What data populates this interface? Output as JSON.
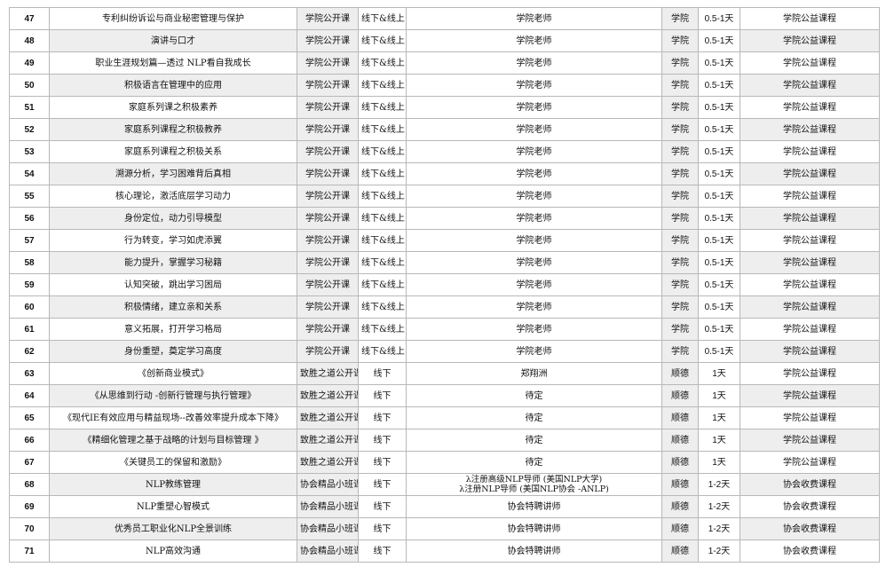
{
  "rows": [
    {
      "no": "47",
      "name": "专利纠纷诉讼与商业秘密管理与保护",
      "type": "学院公开课",
      "mode": "线下&线上",
      "teacher": [
        "学院老师"
      ],
      "place": "学院",
      "duration": "0.5-1天",
      "category": "学院公益课程"
    },
    {
      "no": "48",
      "name": "演讲与口才",
      "type": "学院公开课",
      "mode": "线下&线上",
      "teacher": [
        "学院老师"
      ],
      "place": "学院",
      "duration": "0.5-1天",
      "category": "学院公益课程"
    },
    {
      "no": "49",
      "name": "职业生涯规划篇—透过 NLP看自我成长",
      "type": "学院公开课",
      "mode": "线下&线上",
      "teacher": [
        "学院老师"
      ],
      "place": "学院",
      "duration": "0.5-1天",
      "category": "学院公益课程"
    },
    {
      "no": "50",
      "name": "积极语言在管理中的应用",
      "type": "学院公开课",
      "mode": "线下&线上",
      "teacher": [
        "学院老师"
      ],
      "place": "学院",
      "duration": "0.5-1天",
      "category": "学院公益课程"
    },
    {
      "no": "51",
      "name": "家庭系列课之积极素养",
      "type": "学院公开课",
      "mode": "线下&线上",
      "teacher": [
        "学院老师"
      ],
      "place": "学院",
      "duration": "0.5-1天",
      "category": "学院公益课程"
    },
    {
      "no": "52",
      "name": "家庭系列课程之积极教养",
      "type": "学院公开课",
      "mode": "线下&线上",
      "teacher": [
        "学院老师"
      ],
      "place": "学院",
      "duration": "0.5-1天",
      "category": "学院公益课程"
    },
    {
      "no": "53",
      "name": "家庭系列课程之积极关系",
      "type": "学院公开课",
      "mode": "线下&线上",
      "teacher": [
        "学院老师"
      ],
      "place": "学院",
      "duration": "0.5-1天",
      "category": "学院公益课程"
    },
    {
      "no": "54",
      "name": "溯源分析，学习困难背后真相",
      "type": "学院公开课",
      "mode": "线下&线上",
      "teacher": [
        "学院老师"
      ],
      "place": "学院",
      "duration": "0.5-1天",
      "category": "学院公益课程"
    },
    {
      "no": "55",
      "name": "核心理论，激活底层学习动力",
      "type": "学院公开课",
      "mode": "线下&线上",
      "teacher": [
        "学院老师"
      ],
      "place": "学院",
      "duration": "0.5-1天",
      "category": "学院公益课程"
    },
    {
      "no": "56",
      "name": "身份定位，动力引导模型",
      "type": "学院公开课",
      "mode": "线下&线上",
      "teacher": [
        "学院老师"
      ],
      "place": "学院",
      "duration": "0.5-1天",
      "category": "学院公益课程"
    },
    {
      "no": "57",
      "name": "行为转变，学习如虎添翼",
      "type": "学院公开课",
      "mode": "线下&线上",
      "teacher": [
        "学院老师"
      ],
      "place": "学院",
      "duration": "0.5-1天",
      "category": "学院公益课程"
    },
    {
      "no": "58",
      "name": "能力提升，掌握学习秘籍",
      "type": "学院公开课",
      "mode": "线下&线上",
      "teacher": [
        "学院老师"
      ],
      "place": "学院",
      "duration": "0.5-1天",
      "category": "学院公益课程"
    },
    {
      "no": "59",
      "name": "认知突破，跳出学习困局",
      "type": "学院公开课",
      "mode": "线下&线上",
      "teacher": [
        "学院老师"
      ],
      "place": "学院",
      "duration": "0.5-1天",
      "category": "学院公益课程"
    },
    {
      "no": "60",
      "name": "积极情绪，建立亲和关系",
      "type": "学院公开课",
      "mode": "线下&线上",
      "teacher": [
        "学院老师"
      ],
      "place": "学院",
      "duration": "0.5-1天",
      "category": "学院公益课程"
    },
    {
      "no": "61",
      "name": "意义拓展，打开学习格局",
      "type": "学院公开课",
      "mode": "线下&线上",
      "teacher": [
        "学院老师"
      ],
      "place": "学院",
      "duration": "0.5-1天",
      "category": "学院公益课程"
    },
    {
      "no": "62",
      "name": "身份重塑，奠定学习高度",
      "type": "学院公开课",
      "mode": "线下&线上",
      "teacher": [
        "学院老师"
      ],
      "place": "学院",
      "duration": "0.5-1天",
      "category": "学院公益课程"
    },
    {
      "no": "63",
      "name": "《创新商业模式》",
      "type": "致胜之道公开课",
      "mode": "线下",
      "teacher": [
        "郑翔洲"
      ],
      "place": "顺德",
      "duration": "1天",
      "category": "学院公益课程"
    },
    {
      "no": "64",
      "name": "《从思维到行动 -创新行管理与执行管理》",
      "type": "致胜之道公开课",
      "mode": "线下",
      "teacher": [
        "待定"
      ],
      "place": "顺德",
      "duration": "1天",
      "category": "学院公益课程"
    },
    {
      "no": "65",
      "name": "《现代IE有效应用与精益现场--改善效率提升成本下降》",
      "type": "致胜之道公开课",
      "mode": "线下",
      "teacher": [
        "待定"
      ],
      "place": "顺德",
      "duration": "1天",
      "category": "学院公益课程"
    },
    {
      "no": "66",
      "name": "《精细化管理之基于战略的计划与目标管理 》",
      "type": "致胜之道公开课",
      "mode": "线下",
      "teacher": [
        "待定"
      ],
      "place": "顺德",
      "duration": "1天",
      "category": "学院公益课程"
    },
    {
      "no": "67",
      "name": "《关键员工的保留和激励》",
      "type": "致胜之道公开课",
      "mode": "线下",
      "teacher": [
        "待定"
      ],
      "place": "顺德",
      "duration": "1天",
      "category": "学院公益课程"
    },
    {
      "no": "68",
      "name": "NLP教练管理",
      "type": "协会精品小班课",
      "mode": "线下",
      "teacher": [
        "λ注册高级NLP导师 (美国NLP大学)",
        "λ注册NLP导师 (美国NLP协会 -ANLP)"
      ],
      "place": "顺德",
      "duration": "1-2天",
      "category": "协会收费课程"
    },
    {
      "no": "69",
      "name": "NLP重塑心智模式",
      "type": "协会精品小班课",
      "mode": "线下",
      "teacher": [
        "协会特聘讲师"
      ],
      "place": "顺德",
      "duration": "1-2天",
      "category": "协会收费课程"
    },
    {
      "no": "70",
      "name": "优秀员工职业化NLP全景训练",
      "type": "协会精品小班课",
      "mode": "线下",
      "teacher": [
        "协会特聘讲师"
      ],
      "place": "顺德",
      "duration": "1-2天",
      "category": "协会收费课程"
    },
    {
      "no": "71",
      "name": "NLP高效沟通",
      "type": "协会精品小班课",
      "mode": "线下",
      "teacher": [
        "协会特聘讲师"
      ],
      "place": "顺德",
      "duration": "1-2天",
      "category": "协会收费课程"
    }
  ]
}
